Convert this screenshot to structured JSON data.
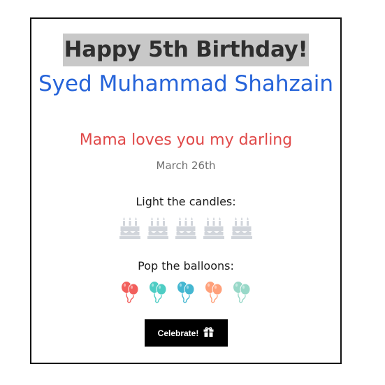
{
  "card": {
    "title": "Happy 5th Birthday!",
    "name": "Syed Muhammad Shahzain",
    "message": "Mama loves you my darling",
    "date": "March 26th"
  },
  "candles": {
    "label": "Light the candles:",
    "icon": "birthday-cake-icon",
    "count": 5,
    "lit": 0,
    "color": "#d1d5db"
  },
  "balloons": {
    "label": "Pop the balloons:",
    "icon": "balloons-icon",
    "colors": [
      "#f25f5c",
      "#4ecdc4",
      "#45b7d1",
      "#ffa07a",
      "#98d8c8"
    ]
  },
  "celebrate_button": {
    "label": "Celebrate!",
    "icon": "gift-icon"
  },
  "colors": {
    "title_bg": "#c8c8c8",
    "name": "#2563d9",
    "message": "#e04848",
    "date": "#707070",
    "button_bg": "#000000"
  }
}
